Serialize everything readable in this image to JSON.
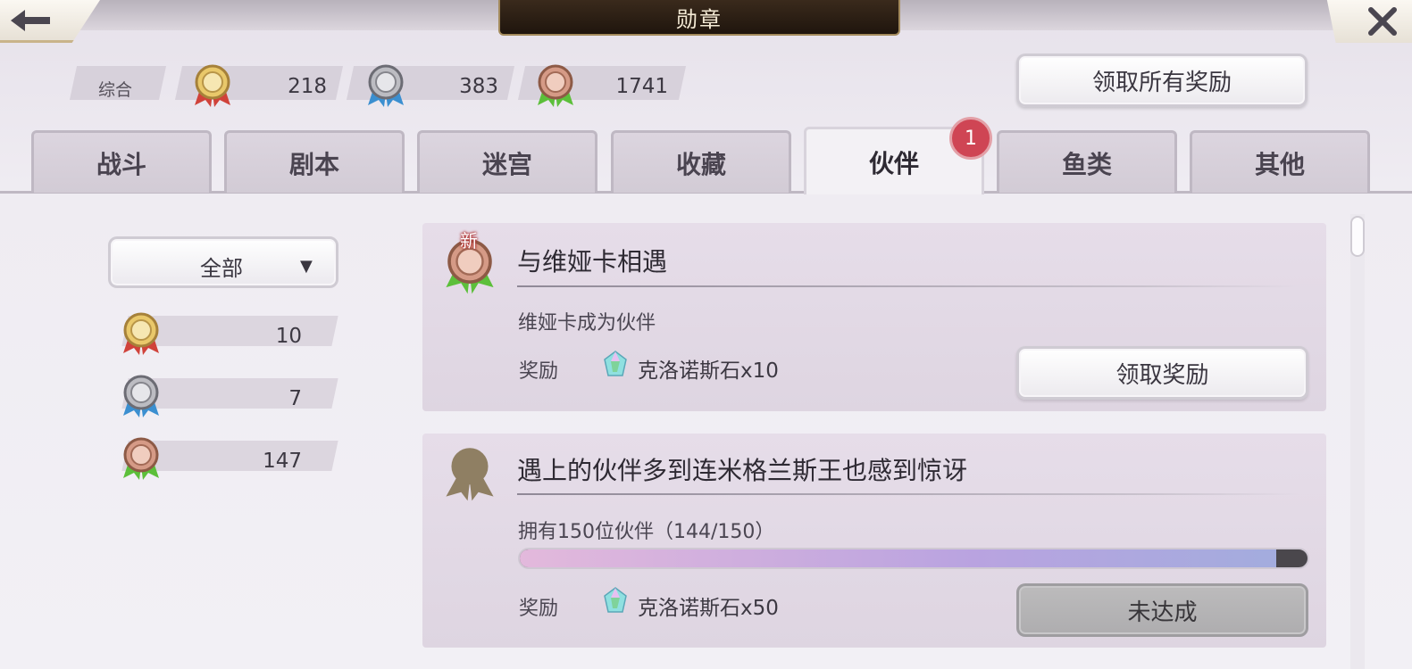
{
  "header": {
    "title": "勋章",
    "back_icon": "arrow-left-icon",
    "close_icon": "close-icon"
  },
  "summary": {
    "label": "综合",
    "gold": "218",
    "silver": "383",
    "bronze": "1741"
  },
  "claim_all_label": "领取所有奖励",
  "tabs": [
    {
      "label": "战斗"
    },
    {
      "label": "剧本"
    },
    {
      "label": "迷宫"
    },
    {
      "label": "收藏"
    },
    {
      "label": "伙伴",
      "active": true
    },
    {
      "label": "鱼类"
    },
    {
      "label": "其他"
    }
  ],
  "tab_badge": "1",
  "filter": {
    "selected": "全部",
    "counts": {
      "gold": "10",
      "silver": "7",
      "bronze": "147"
    }
  },
  "cards": [
    {
      "new_tag": "新",
      "title": "与维娅卡相遇",
      "desc": "维娅卡成为伙伴",
      "reward_label": "奖励",
      "reward": "克洛诺斯石x10",
      "button": "领取奖励",
      "medal": "bronze"
    },
    {
      "title": "遇上的伙伴多到连米格兰斯王也感到惊讶",
      "desc": "拥有150位伙伴（144/150）",
      "progress": 0.96,
      "reward_label": "奖励",
      "reward": "克洛诺斯石x50",
      "button": "未达成",
      "medal": "locked"
    }
  ],
  "colors": {
    "gold_ribbon": "#d0423a",
    "silver_ribbon": "#3b8fd0",
    "bronze_ribbon": "#5cbf3a",
    "badge": "#cf4554"
  }
}
